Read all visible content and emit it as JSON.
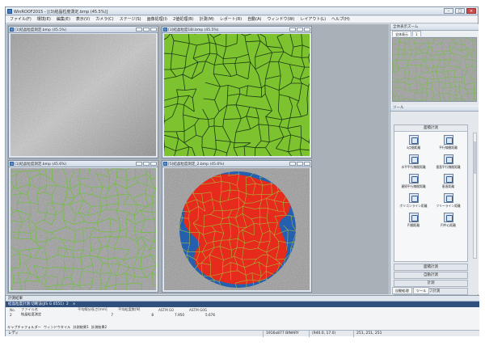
{
  "window": {
    "title": "WinROOF2015 - [(3)結晶粒度測定.bmp (45.5%)]"
  },
  "menu": [
    "ファイル(F)",
    "環境(E)",
    "編集(E)",
    "表示(V)",
    "カメラ(C)",
    "ステージ(S)",
    "画像処理(I)",
    "2値処理(B)",
    "計測(M)",
    "レポート(R)",
    "自動(A)",
    "ウィンドウ(W)",
    "レイアウト(L)",
    "ヘルプ(H)"
  ],
  "children": [
    {
      "title": "[1]結晶粒度測定.bmp (45.5%)",
      "kind": "gray"
    },
    {
      "title": "[1]結晶粒度1BI.bmp (45.5%)",
      "kind": "green"
    },
    {
      "title": "[1]結晶粒度測定.bmp (45.6%)",
      "kind": "overlay"
    },
    {
      "title": "[5]結晶粒度測定_2.bmp (45.6%)",
      "kind": "circle"
    }
  ],
  "side": {
    "thumb_title": "全体表示ズーム",
    "thumb_tabs": [
      "全体表示",
      "1"
    ],
    "tool_title": "ツール",
    "tool_header": "面積計測",
    "tools": [
      "3点間距離",
      "平行線間距離",
      "水平平行線間距離",
      "垂直平行線間距離",
      "連続平行線間距離",
      "垂直距離",
      "ポリゴンライン距離",
      "フリーライン距離",
      "円間距離",
      "円中心距離"
    ],
    "rows": [
      "面積計測",
      "自動計測",
      "計測",
      "グラフ計測"
    ],
    "tabs": [
      "自動処理",
      "ツール"
    ]
  },
  "bottom": {
    "panel_title": "計測結果",
    "result_title": "結晶粒度計測:切断法(JIS G 0551)",
    "result_index": "2",
    "columns": [
      "No.",
      "ファイル名",
      "平均線分長さ[mm]",
      "平均粒度数[N]",
      "ASTM G0",
      "ASTM G0G"
    ],
    "rows": [
      [
        "2",
        "結晶粒度測定",
        "7",
        "8",
        "7.950",
        "5.676"
      ]
    ],
    "tabs": [
      "キャプチャフォルダー",
      "ウィンドウタイル",
      "計測結果1",
      "計測結果2"
    ]
  },
  "status": {
    "ready": "レディ",
    "mode": "1916x877 BINARY",
    "coords": "(940.0, 17.0)",
    "rgb": "251, 251, 251"
  },
  "colors": {
    "grain_green": "#7dc22f",
    "boundary_dark": "#1a3a12",
    "phase_red": "#e62a1c",
    "background_blue": "#2560b0",
    "mesh_green": "#6ec23b",
    "title_blue": "#2f4f7f"
  }
}
